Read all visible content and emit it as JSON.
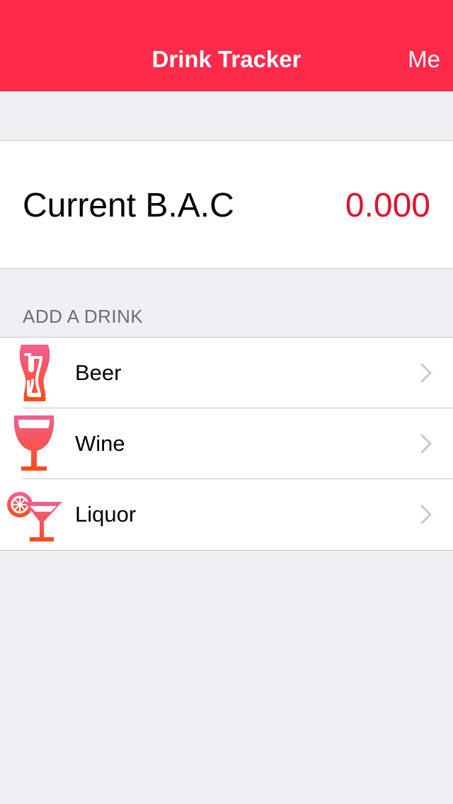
{
  "navbar": {
    "title": "Drink Tracker",
    "right_button": "Me",
    "color": "#ff2a4a"
  },
  "bac": {
    "label": "Current B.A.C",
    "value": "0.000",
    "value_color": "#e3102f"
  },
  "section": {
    "header": "ADD A DRINK"
  },
  "drinks": [
    {
      "label": "Beer",
      "icon": "beer-glass-icon"
    },
    {
      "label": "Wine",
      "icon": "wine-glass-icon"
    },
    {
      "label": "Liquor",
      "icon": "cocktail-glass-icon"
    }
  ]
}
